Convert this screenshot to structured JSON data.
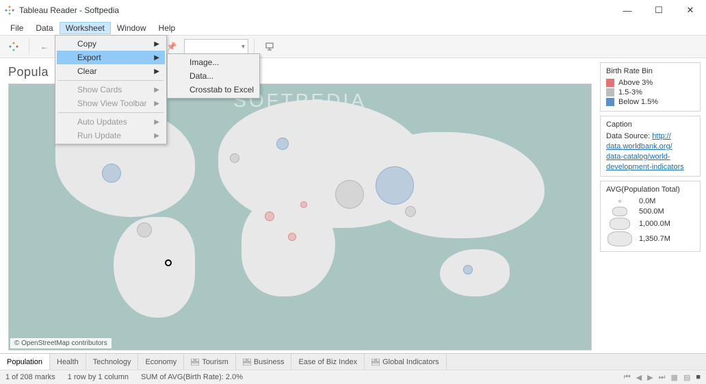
{
  "window": {
    "title": "Tableau Reader - Softpedia"
  },
  "menubar": {
    "items": [
      "File",
      "Data",
      "Worksheet",
      "Window",
      "Help"
    ],
    "open_index": 2
  },
  "worksheet_menu": {
    "items": [
      {
        "label": "Copy",
        "submenu": true
      },
      {
        "label": "Export",
        "submenu": true,
        "hover": true
      },
      {
        "label": "Clear",
        "submenu": true
      },
      {
        "sep": true
      },
      {
        "label": "Show Cards",
        "submenu": true,
        "disabled": true
      },
      {
        "label": "Show View Toolbar",
        "submenu": true,
        "disabled": true
      },
      {
        "sep": true
      },
      {
        "label": "Auto Updates",
        "submenu": true,
        "disabled": true
      },
      {
        "label": "Run Update",
        "submenu": true,
        "disabled": true
      }
    ]
  },
  "export_submenu": {
    "items": [
      "Image...",
      "Data...",
      "Crosstab to Excel"
    ]
  },
  "viz": {
    "title": "Popula",
    "attribution": "© OpenStreetMap contributors",
    "watermark": "SOFTPEDIA"
  },
  "legend_color": {
    "title": "Birth Rate Bin",
    "items": [
      {
        "color": "#e57373",
        "label": "Above 3%"
      },
      {
        "color": "#bdbdbd",
        "label": "1.5-3%"
      },
      {
        "color": "#5b8fc7",
        "label": "Below 1.5%"
      }
    ]
  },
  "caption": {
    "title": "Caption",
    "prefix": "Data Source: ",
    "link_lines": [
      "http://",
      "data.worldbank.org/",
      "data-catalog/world-",
      "development-indicators"
    ]
  },
  "legend_size": {
    "title": "AVG(Population Total)",
    "items": [
      {
        "w": 4,
        "h": 4,
        "label": "0.0M"
      },
      {
        "w": 22,
        "h": 14,
        "label": "500.0M"
      },
      {
        "w": 30,
        "h": 18,
        "label": "1,000.0M"
      },
      {
        "w": 36,
        "h": 22,
        "label": "1,350.7M"
      }
    ]
  },
  "tabs": {
    "items": [
      {
        "label": "Population",
        "active": true
      },
      {
        "label": "Health"
      },
      {
        "label": "Technology"
      },
      {
        "label": "Economy"
      },
      {
        "label": "Tourism",
        "icon": true
      },
      {
        "label": "Business",
        "icon": true
      },
      {
        "label": "Ease of Biz Index"
      },
      {
        "label": "Global Indicators",
        "icon": true
      }
    ]
  },
  "status": {
    "marks": "1 of 208 marks",
    "dims": "1 row by 1 column",
    "agg": "SUM of AVG(Birth Rate): 2.0%"
  }
}
